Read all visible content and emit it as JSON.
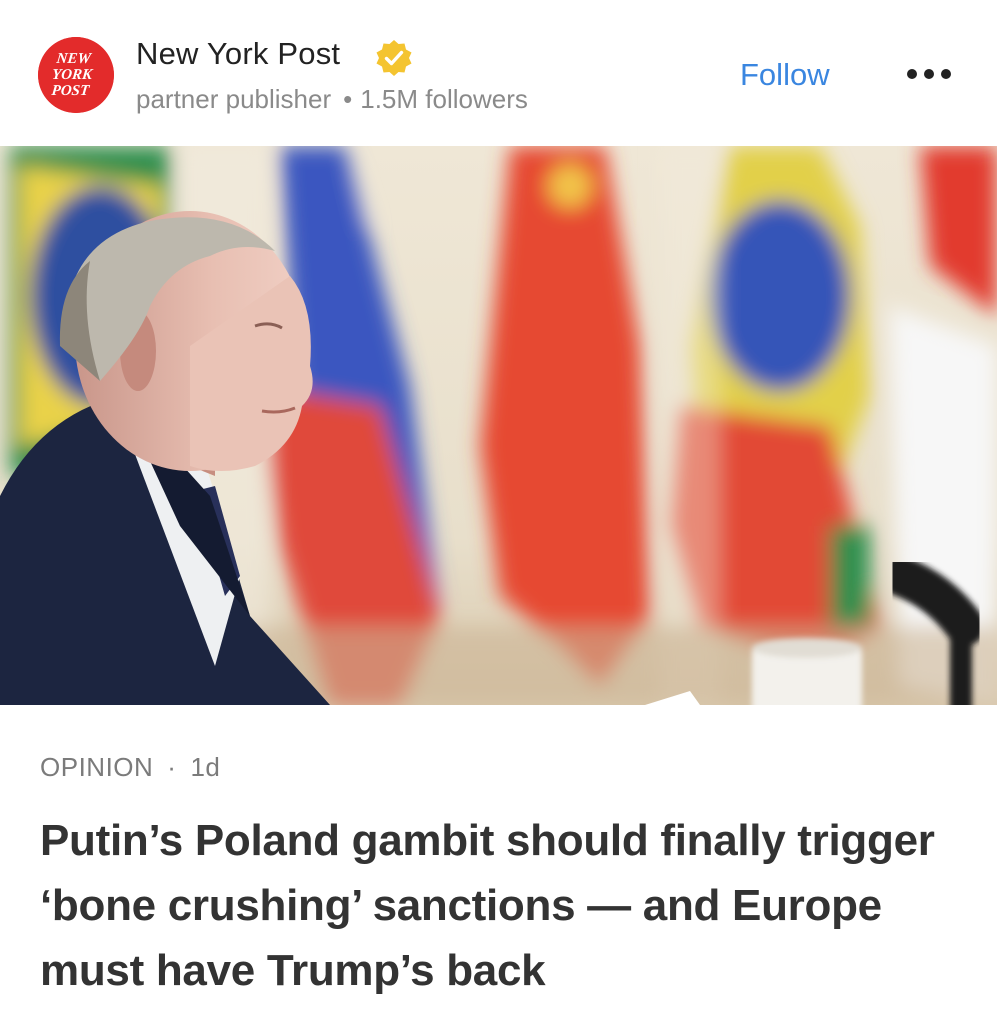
{
  "publisher": {
    "name": "New York Post",
    "logo_text": [
      "NEW",
      "YORK",
      "POST"
    ],
    "role": "partner publisher",
    "followers": "1.5M followers",
    "verified_icon": "verified-badge-icon"
  },
  "actions": {
    "follow_label": "Follow",
    "more_icon": "more-options-icon"
  },
  "hero_image": {
    "description_icon": "article-photo"
  },
  "article": {
    "category": "OPINION",
    "separator": "·",
    "age": "1d",
    "headline": "Putin’s Poland gambit should finally trigger ‘bone crushing’ sanctions — and Europe must have Trump’s back"
  },
  "colors": {
    "accent_blue": "#3a86e0",
    "brand_red": "#e32b2b",
    "badge_gold": "#f4c430"
  }
}
